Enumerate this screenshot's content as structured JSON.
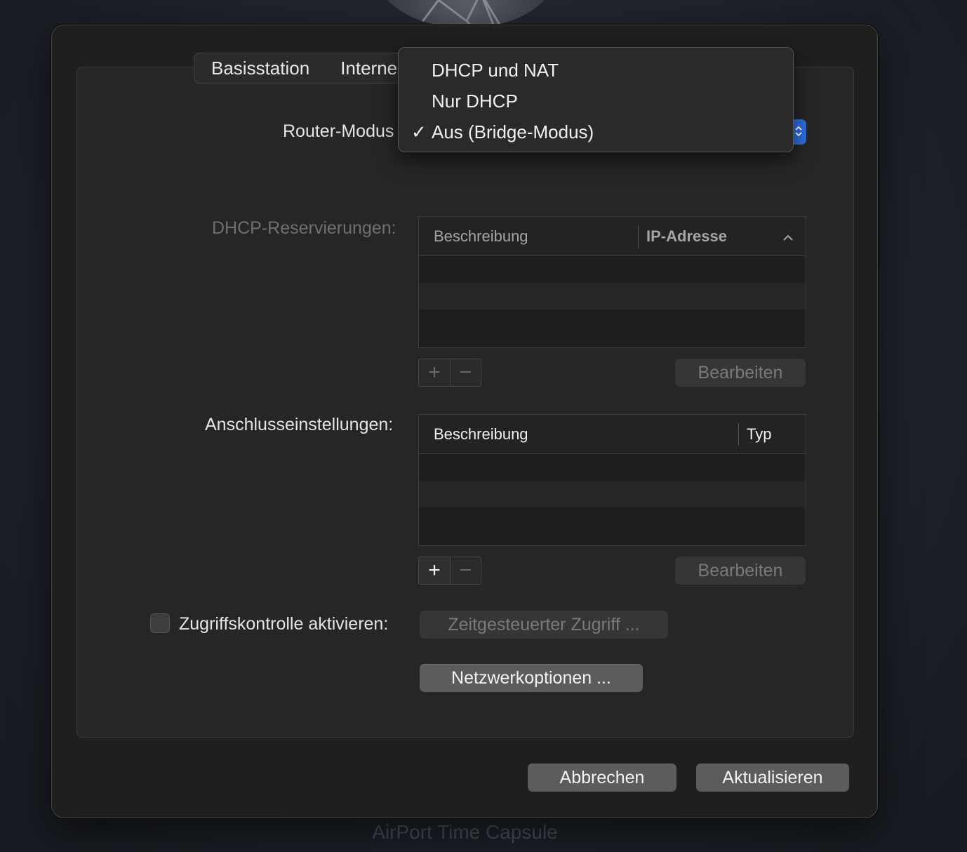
{
  "device_caption": "AirPort Time Capsule",
  "tabs": [
    {
      "label": "Basisstation"
    },
    {
      "label": "Interne"
    }
  ],
  "router_mode": {
    "label": "Router-Modus",
    "menu": [
      {
        "label": "DHCP und NAT",
        "checked": false
      },
      {
        "label": "Nur DHCP",
        "checked": false
      },
      {
        "label": "Aus (Bridge-Modus)",
        "checked": true
      }
    ],
    "check_glyph": "✓"
  },
  "dhcp_reservations": {
    "label": "DHCP-Reservierungen:",
    "columns": [
      "Beschreibung",
      "IP-Adresse"
    ],
    "sort_icon": "chevron-up-icon",
    "add_label": "+",
    "remove_label": "−",
    "edit_label": "Bearbeiten"
  },
  "port_settings": {
    "label": "Anschlusseinstellungen:",
    "columns": [
      "Beschreibung",
      "Typ"
    ],
    "add_label": "+",
    "remove_label": "−",
    "edit_label": "Bearbeiten"
  },
  "access_control": {
    "label": "Zugriffskontrolle aktivieren:",
    "checked": false,
    "timed_access_label": "Zeitgesteuerter Zugriff ..."
  },
  "network_options_label": "Netzwerkoptionen ...",
  "footer": {
    "cancel_label": "Abbrechen",
    "update_label": "Aktualisieren"
  },
  "colors": {
    "accent": "#2f6fe0",
    "sheet_bg": "#1f1f1f",
    "panel_bg": "#262626"
  }
}
